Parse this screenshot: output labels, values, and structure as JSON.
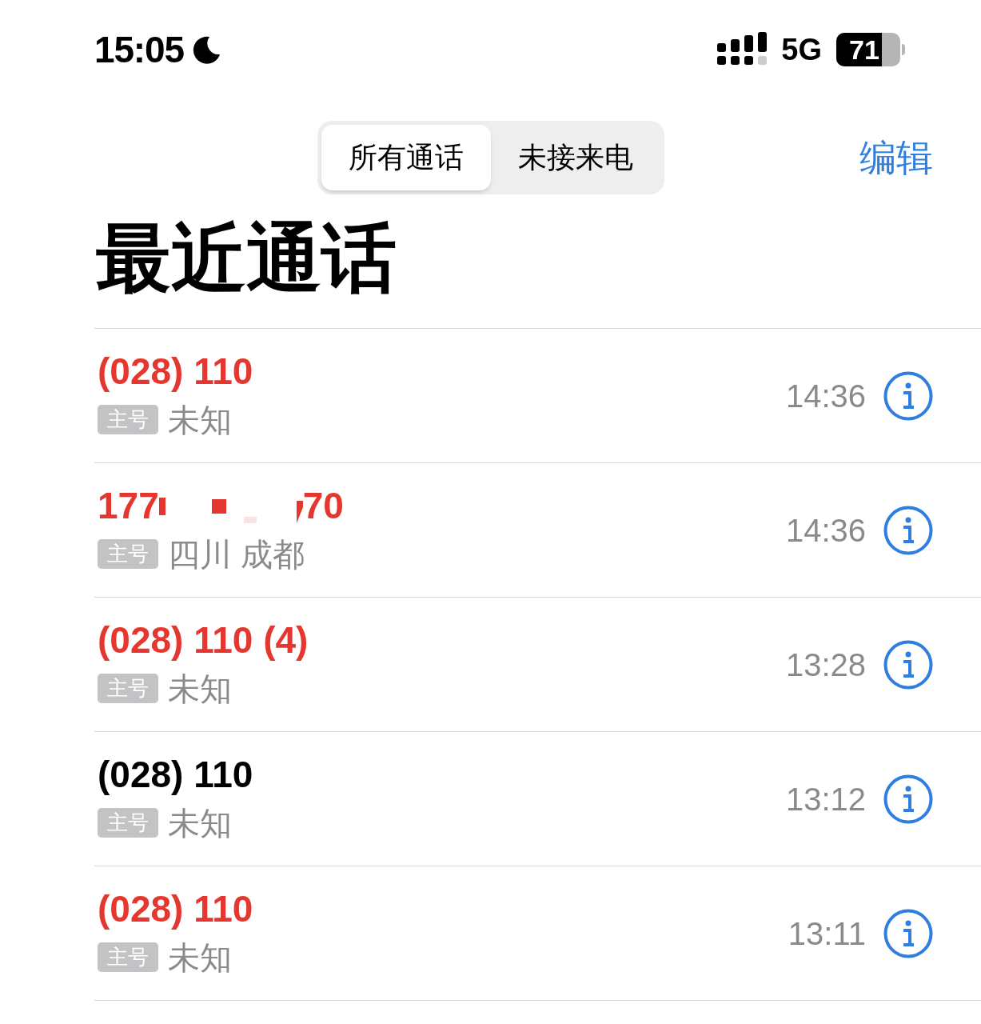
{
  "status_bar": {
    "time": "15:05",
    "network": "5G",
    "battery": "71"
  },
  "segments": [
    {
      "label": "所有通话",
      "selected": true
    },
    {
      "label": "未接来电",
      "selected": false
    }
  ],
  "edit_button": "编辑",
  "title": "最近通话",
  "calls": [
    {
      "number_parts": [
        "(028) 110"
      ],
      "missed": true,
      "tag": "主号",
      "location": "未知",
      "time": "14:36"
    },
    {
      "number_parts": [
        "177",
        "70"
      ],
      "missed": true,
      "tag": "主号",
      "location": "四川 成都",
      "time": "14:36"
    },
    {
      "number_parts": [
        "(028) 110 (4)"
      ],
      "missed": true,
      "tag": "主号",
      "location": "未知",
      "time": "13:28"
    },
    {
      "number_parts": [
        "(028) 110"
      ],
      "missed": false,
      "tag": "主号",
      "location": "未知",
      "time": "13:12"
    },
    {
      "number_parts": [
        "(028) 110"
      ],
      "missed": true,
      "tag": "主号",
      "location": "未知",
      "time": "13:11"
    }
  ]
}
